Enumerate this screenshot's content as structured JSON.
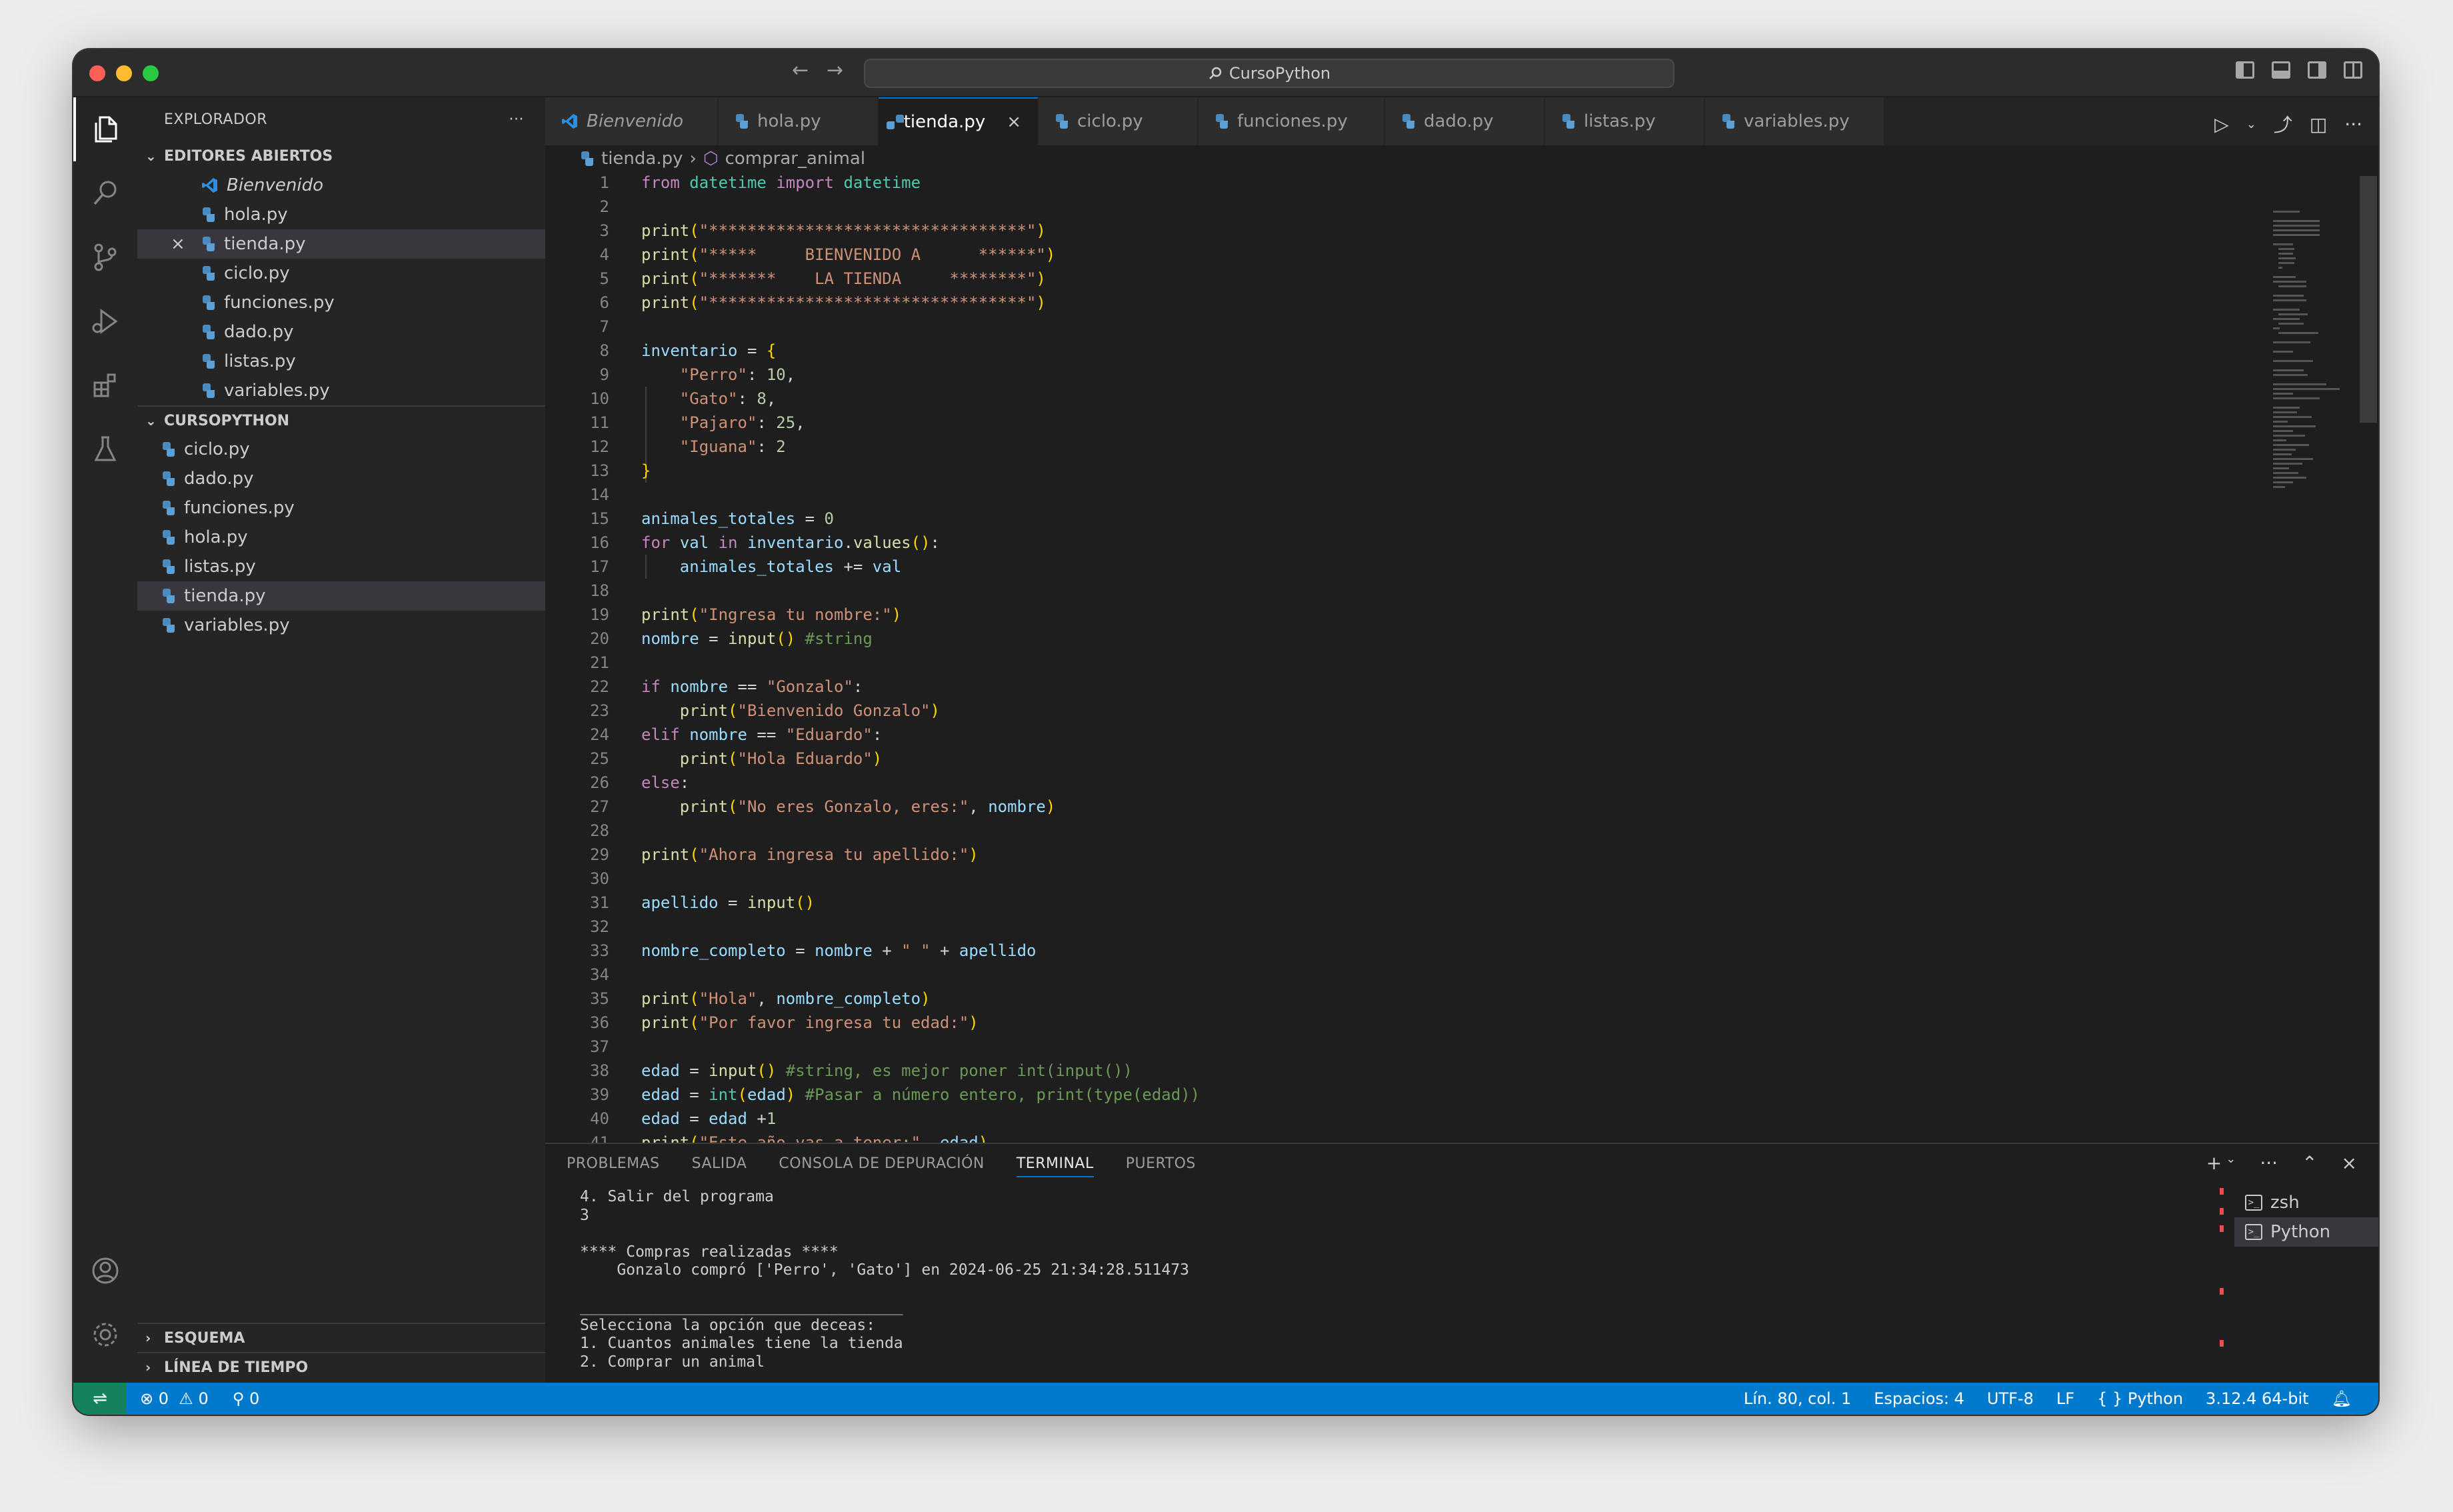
{
  "window": {
    "title": "CursoPython",
    "colors": {
      "accent": "#0078d4",
      "statusbar": "#007acc",
      "editor_bg": "#1e1e1e",
      "sidebar_bg": "#252526"
    }
  },
  "activity_bar": {
    "icons": [
      "files-icon",
      "search-icon",
      "source-control-icon",
      "run-debug-icon",
      "extensions-icon",
      "testing-icon",
      "account-icon",
      "settings-gear-icon"
    ]
  },
  "sidebar": {
    "title": "EXPLORADOR",
    "more": "···",
    "open_editors": {
      "title": "EDITORES ABIERTOS",
      "items": [
        "Bienvenido",
        "hola.py",
        "tienda.py",
        "ciclo.py",
        "funciones.py",
        "dado.py",
        "listas.py",
        "variables.py"
      ]
    },
    "project": {
      "title": "CURSOPYTHON",
      "items": [
        "ciclo.py",
        "dado.py",
        "funciones.py",
        "hola.py",
        "listas.py",
        "tienda.py",
        "variables.py"
      ]
    },
    "outline": "ESQUEMA",
    "timeline": "LÍNEA DE TIEMPO"
  },
  "tabs": [
    "Bienvenido",
    "hola.py",
    "tienda.py",
    "ciclo.py",
    "funciones.py",
    "dado.py",
    "listas.py",
    "variables.py"
  ],
  "breadcrumb": {
    "file": "tienda.py",
    "symbol": "comprar_animal"
  },
  "code_lines": [
    "1",
    "2",
    "3",
    "4",
    "5",
    "6",
    "7",
    "8",
    "9",
    "10",
    "11",
    "12",
    "13",
    "14",
    "15",
    "16",
    "17",
    "18",
    "19",
    "20",
    "21",
    "22",
    "23",
    "24",
    "25",
    "26",
    "27",
    "28",
    "29",
    "30",
    "31",
    "32",
    "33",
    "34",
    "35",
    "36",
    "37",
    "38",
    "39",
    "40",
    "41"
  ],
  "code": {
    "l1": [
      "from",
      "datetime",
      "import",
      "datetime"
    ],
    "l3": "\"*********************************\"",
    "l4": "\"*****     BIENVENIDO A      ******\"",
    "l5": "\"*******    LA TIENDA     ********\"",
    "l6": "\"*********************************\"",
    "l8_var": "inventario",
    "inv": [
      {
        "key": "\"Perro\"",
        "val": "10"
      },
      {
        "key": "\"Gato\"",
        "val": "8"
      },
      {
        "key": "\"Pajaro\"",
        "val": "25"
      },
      {
        "key": "\"Iguana\"",
        "val": "2"
      }
    ],
    "l15": "animales_totales",
    "l15_val": "0",
    "l16": [
      "for",
      "val",
      "in",
      "inventario",
      "values"
    ],
    "l17": [
      "animales_totales",
      "+=",
      "val"
    ],
    "l19": "\"Ingresa tu nombre:\"",
    "l20": [
      "nombre",
      "input",
      "#string"
    ],
    "l22": [
      "if",
      "nombre",
      "==",
      "\"Gonzalo\""
    ],
    "l23": "\"Bienvenido Gonzalo\"",
    "l24": [
      "elif",
      "nombre",
      "==",
      "\"Eduardo\""
    ],
    "l25": "\"Hola Eduardo\"",
    "l26": "else",
    "l27": [
      "\"No eres Gonzalo, eres:\"",
      "nombre"
    ],
    "l29": "\"Ahora ingresa tu apellido:\"",
    "l31": [
      "apellido",
      "input"
    ],
    "l33": [
      "nombre_completo",
      "nombre",
      "\" \"",
      "apellido"
    ],
    "l35": [
      "\"Hola\"",
      "nombre_completo"
    ],
    "l36": "\"Por favor ingresa tu edad:\"",
    "l38": [
      "edad",
      "input",
      "#string, es mejor poner int(input())"
    ],
    "l39": [
      "edad",
      "int",
      "edad",
      "#Pasar a número entero, print(type(edad))"
    ],
    "l40": [
      "edad",
      "edad",
      "1"
    ],
    "l41": [
      "\"Este año vas a tener:\"",
      "edad"
    ]
  },
  "panel": {
    "tabs": [
      "PROBLEMAS",
      "SALIDA",
      "CONSOLA DE DEPURACIÓN",
      "TERMINAL",
      "PUERTOS"
    ],
    "active_tab": "TERMINAL",
    "terminal_lines": [
      "4. Salir del programa",
      "3",
      "",
      "**** Compras realizadas ****",
      "    Gonzalo compró ['Perro', 'Gato'] en 2024-06-25 21:34:28.511473",
      "",
      "___________________________________",
      "Selecciona la opción que deceas:",
      "1. Cuantos animales tiene la tienda",
      "2. Comprar un animal"
    ],
    "terminals": [
      "zsh",
      "Python"
    ]
  },
  "statusbar": {
    "errors": "0",
    "warnings": "0",
    "ports": "0",
    "position": "Lín. 80, col. 1",
    "spaces": "Espacios: 4",
    "encoding": "UTF-8",
    "eol": "LF",
    "language": "Python",
    "interpreter": "3.12.4 64-bit"
  }
}
